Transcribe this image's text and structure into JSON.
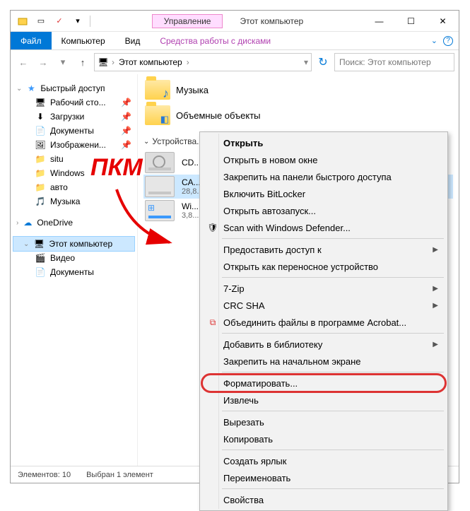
{
  "titlebar": {
    "management_tab": "Управление",
    "title": "Этот компьютер"
  },
  "ribbon": {
    "file": "Файл",
    "computer": "Компьютер",
    "view": "Вид",
    "drive_tools": "Средства работы с дисками"
  },
  "addressbar": {
    "root": "Этот компьютер",
    "sep": "›"
  },
  "search": {
    "placeholder": "Поиск: Этот компьютер"
  },
  "sidebar": {
    "quick": {
      "label": "Быстрый доступ"
    },
    "quick_items": [
      "Рабочий сто...",
      "Загрузки",
      "Документы",
      "Изображени...",
      "situ",
      "Windows",
      "авто",
      "Музыка"
    ],
    "onedrive": "OneDrive",
    "thispc": "Этот компьютер",
    "thispc_items": [
      "Видео",
      "Документы"
    ]
  },
  "main": {
    "music": "Музыка",
    "volumes": "Объемные объекты",
    "group": "Устройства...",
    "cd": "CD...",
    "sel_drive": "CA...",
    "sel_size": "28,8...",
    "win_drive": "Wi...",
    "win_size": "3,8..."
  },
  "statusbar": {
    "count": "Элементов: 10",
    "selection": "Выбран 1 элемент"
  },
  "context": {
    "open": "Открыть",
    "open_new": "Открыть в новом окне",
    "pin_quick": "Закрепить на панели быстрого доступа",
    "bitlocker": "Включить BitLocker",
    "autoplay": "Открыть автозапуск...",
    "defender": "Scan with Windows Defender...",
    "access": "Предоставить доступ к",
    "portable": "Открыть как переносное устройство",
    "sevenzip": "7-Zip",
    "crcsha": "CRC SHA",
    "acrobat": "Объединить файлы в программе Acrobat...",
    "library": "Добавить в библиотеку",
    "pin_start": "Закрепить на начальном экране",
    "format": "Форматировать...",
    "eject": "Извлечь",
    "cut": "Вырезать",
    "copy": "Копировать",
    "shortcut": "Создать ярлык",
    "rename": "Переименовать",
    "properties": "Свойства"
  },
  "annotation": {
    "pkm": "ПКМ"
  }
}
